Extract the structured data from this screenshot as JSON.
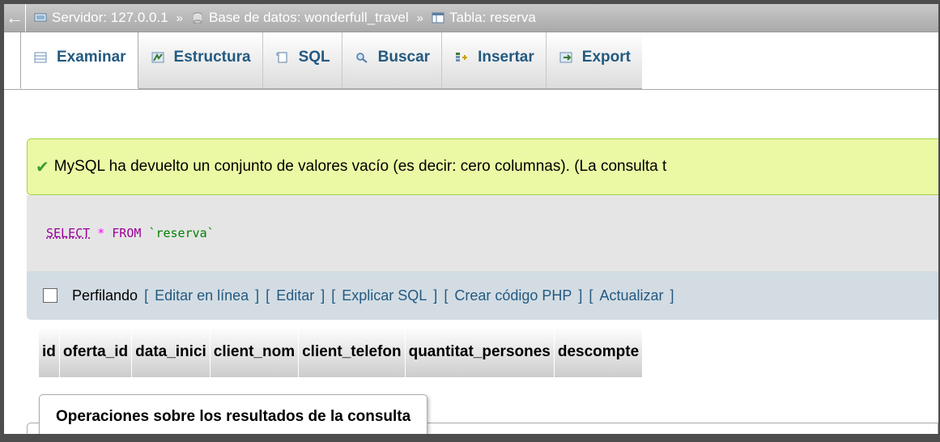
{
  "breadcrumb": {
    "server": "Servidor: 127.0.0.1",
    "database": "Base de datos: wonderfull_travel",
    "table": "Tabla: reserva",
    "separator": "»"
  },
  "tabs": [
    {
      "label": "Examinar",
      "icon": "browse-icon",
      "active": true
    },
    {
      "label": "Estructura",
      "icon": "structure-icon"
    },
    {
      "label": "SQL",
      "icon": "sql-icon"
    },
    {
      "label": "Buscar",
      "icon": "search-icon"
    },
    {
      "label": "Insertar",
      "icon": "insert-icon"
    },
    {
      "label": "Export",
      "icon": "export-icon"
    }
  ],
  "message": {
    "text": "MySQL ha devuelto un conjunto de valores vacío (es decir: cero columnas). (La consulta t",
    "icon": "success-check-icon"
  },
  "query": {
    "select": "SELECT",
    "star": "*",
    "from": "FROM",
    "table": "`reserva`"
  },
  "profiling": {
    "label": "Perfilando",
    "links": [
      "Editar en línea",
      "Editar",
      "Explicar SQL",
      "Crear código PHP",
      "Actualizar"
    ]
  },
  "table": {
    "columns": [
      "id",
      "oferta_id",
      "data_inici",
      "client_nom",
      "client_telefon",
      "quantitat_persones",
      "descompte"
    ]
  },
  "operations": {
    "legend": "Operaciones sobre los resultados de la consulta"
  },
  "colors": {
    "link": "#235a81",
    "success_bg": "#ebf8a4",
    "sql_keyword": "#990099"
  }
}
